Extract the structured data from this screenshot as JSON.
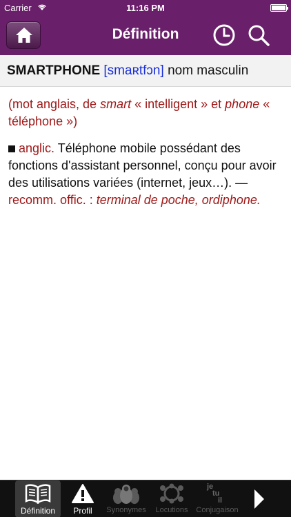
{
  "status_bar": {
    "carrier": "Carrier",
    "time": "11:16 PM"
  },
  "nav": {
    "title": "Définition",
    "home_icon": "home-icon",
    "history_icon": "clock-icon",
    "search_icon": "search-icon"
  },
  "entry": {
    "headword": "SMARTPHONE",
    "pronunciation": "[smaʀtfɔn]",
    "category": "nom masculin",
    "etymology": {
      "open": "(mot anglais, de ",
      "word1": "smart",
      "mid": " « intelligent » et ",
      "word2": "phone",
      "close": " « téléphone »)"
    },
    "definition": {
      "domain": "anglic.",
      "text": " Téléphone mobile possédant des fonctions d'assistant personnel, conçu pour avoir des utilisations variées (internet, jeux…). — ",
      "recommendation": "recomm. offic. : ",
      "official_term": "terminal de poche, ordiphone."
    }
  },
  "tabs": [
    {
      "label": "Définition",
      "icon": "book-icon",
      "active": true,
      "enabled": true
    },
    {
      "label": "Profil",
      "icon": "warning-icon",
      "active": false,
      "enabled": true
    },
    {
      "label": "Synonymes",
      "icon": "nesting-dolls-icon",
      "active": false,
      "enabled": false
    },
    {
      "label": "Locutions",
      "icon": "people-circle-icon",
      "active": false,
      "enabled": false
    },
    {
      "label": "Conjugaison",
      "icon": "conjugation-icon",
      "active": false,
      "enabled": false,
      "icon_text": [
        "je",
        "tu",
        "il"
      ]
    },
    {
      "label": "",
      "icon": "next-arrow-icon",
      "active": false,
      "enabled": true
    }
  ],
  "colors": {
    "bar": "#6a1f6a",
    "accent_red": "#a01818",
    "pronunciation_blue": "#1a2ed8"
  }
}
